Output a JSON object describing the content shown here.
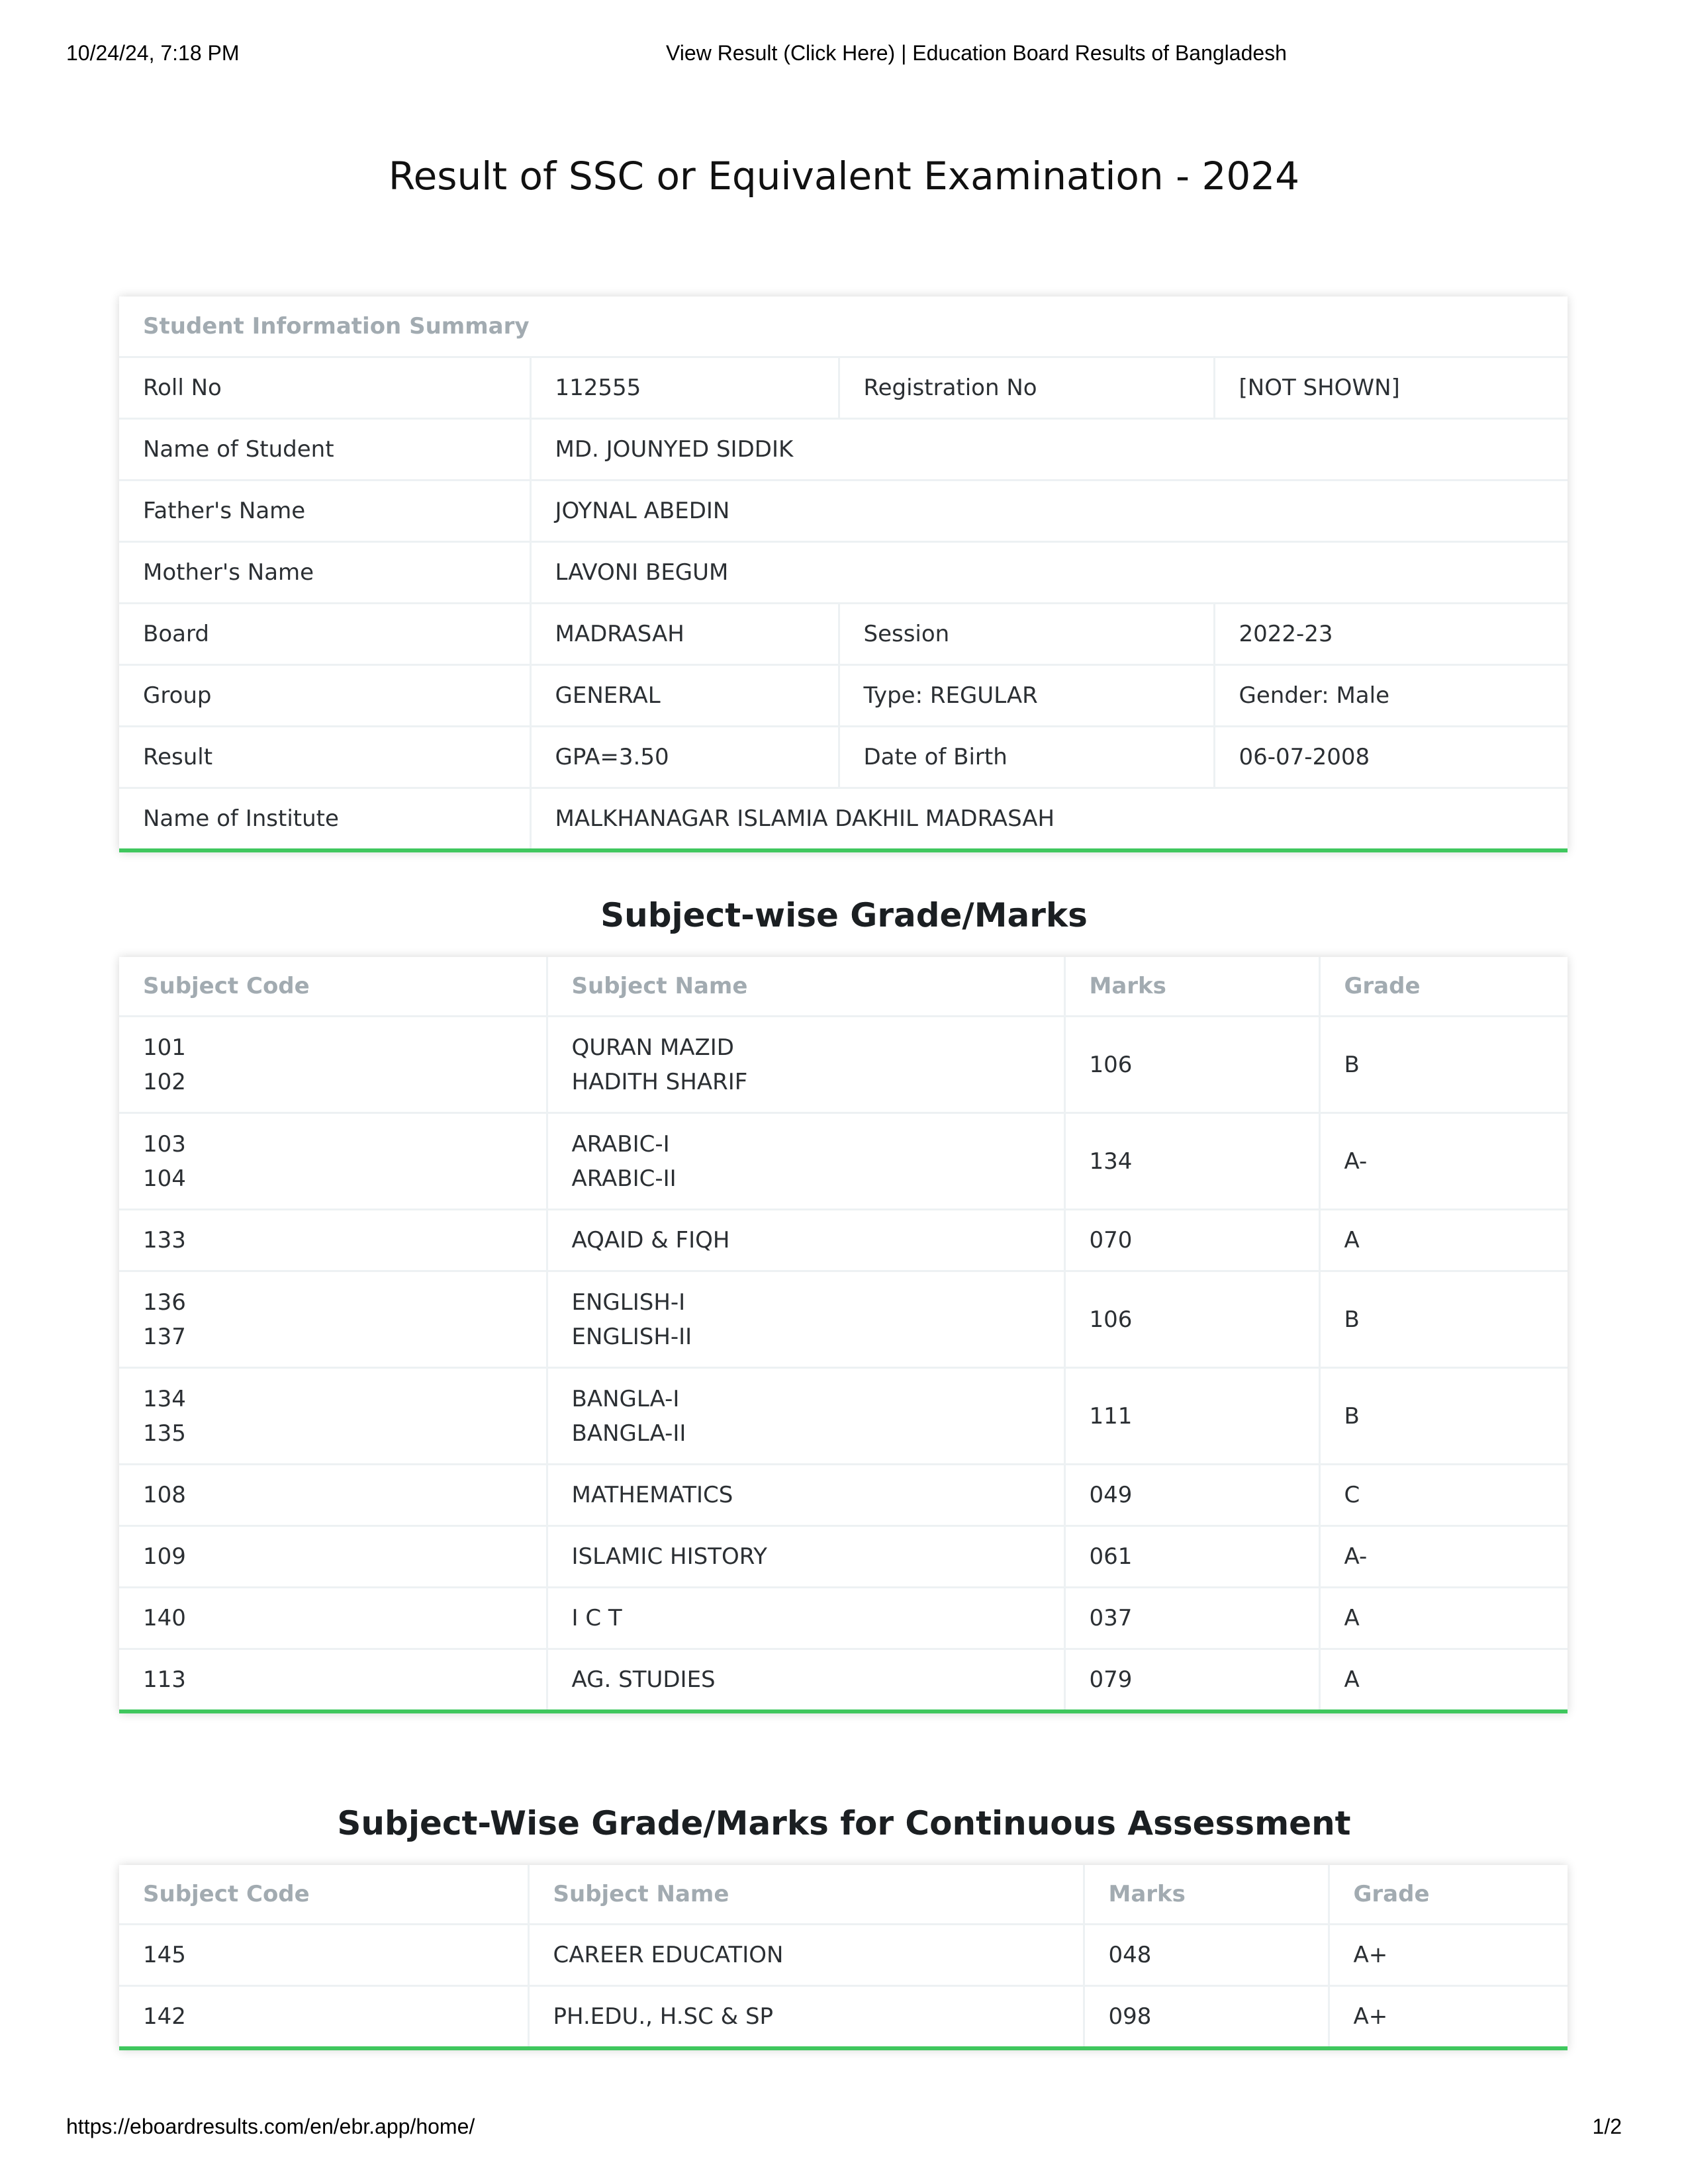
{
  "browser": {
    "timestamp": "10/24/24, 7:18 PM",
    "page_title": "View Result (Click Here) | Education Board Results of Bangladesh",
    "url": "https://eboardresults.com/en/ebr.app/home/",
    "page_number": "1/2"
  },
  "title": "Result of SSC or Equivalent Examination - 2024",
  "summary": {
    "heading": "Student Information Summary",
    "roll_label": "Roll No",
    "roll": "112555",
    "reg_label": "Registration No",
    "reg": "[NOT SHOWN]",
    "name_label": "Name of Student",
    "name": "MD. JOUNYED SIDDIK",
    "father_label": "Father's Name",
    "father": "JOYNAL ABEDIN",
    "mother_label": "Mother's Name",
    "mother": "LAVONI BEGUM",
    "board_label": "Board",
    "board": "MADRASAH",
    "session_label": "Session",
    "session": "2022-23",
    "group_label": "Group",
    "group": "GENERAL",
    "type": "Type: REGULAR",
    "gender": "Gender: Male",
    "result_label": "Result",
    "result": "GPA=3.50",
    "dob_label": "Date of Birth",
    "dob": "06-07-2008",
    "institute_label": "Name of Institute",
    "institute": "MALKHANAGAR ISLAMIA DAKHIL MADRASAH"
  },
  "subjects": {
    "heading": "Subject-wise Grade/Marks",
    "columns": [
      "Subject Code",
      "Subject Name",
      "Marks",
      "Grade"
    ],
    "rows": [
      {
        "code1": "101",
        "code2": "102",
        "name1": "QURAN MAZID",
        "name2": "HADITH SHARIF",
        "marks": "106",
        "grade": "B"
      },
      {
        "code1": "103",
        "code2": "104",
        "name1": "ARABIC-I",
        "name2": "ARABIC-II",
        "marks": "134",
        "grade": "A-"
      },
      {
        "code1": "133",
        "name1": "AQAID & FIQH",
        "marks": "070",
        "grade": "A"
      },
      {
        "code1": "136",
        "code2": "137",
        "name1": "ENGLISH-I",
        "name2": "ENGLISH-II",
        "marks": "106",
        "grade": "B"
      },
      {
        "code1": "134",
        "code2": "135",
        "name1": "BANGLA-I",
        "name2": "BANGLA-II",
        "marks": "111",
        "grade": "B"
      },
      {
        "code1": "108",
        "name1": "MATHEMATICS",
        "marks": "049",
        "grade": "C"
      },
      {
        "code1": "109",
        "name1": "ISLAMIC HISTORY",
        "marks": "061",
        "grade": "A-"
      },
      {
        "code1": "140",
        "name1": "I C T",
        "marks": "037",
        "grade": "A"
      },
      {
        "code1": "113",
        "name1": "AG. STUDIES",
        "marks": "079",
        "grade": "A"
      }
    ]
  },
  "continuous": {
    "heading": "Subject-Wise Grade/Marks for Continuous Assessment",
    "columns": [
      "Subject Code",
      "Subject Name",
      "Marks",
      "Grade"
    ],
    "rows": [
      {
        "code": "145",
        "name": "CAREER EDUCATION",
        "marks": "048",
        "grade": "A+"
      },
      {
        "code": "142",
        "name": "PH.EDU., H.SC & SP",
        "marks": "098",
        "grade": "A+"
      }
    ]
  }
}
